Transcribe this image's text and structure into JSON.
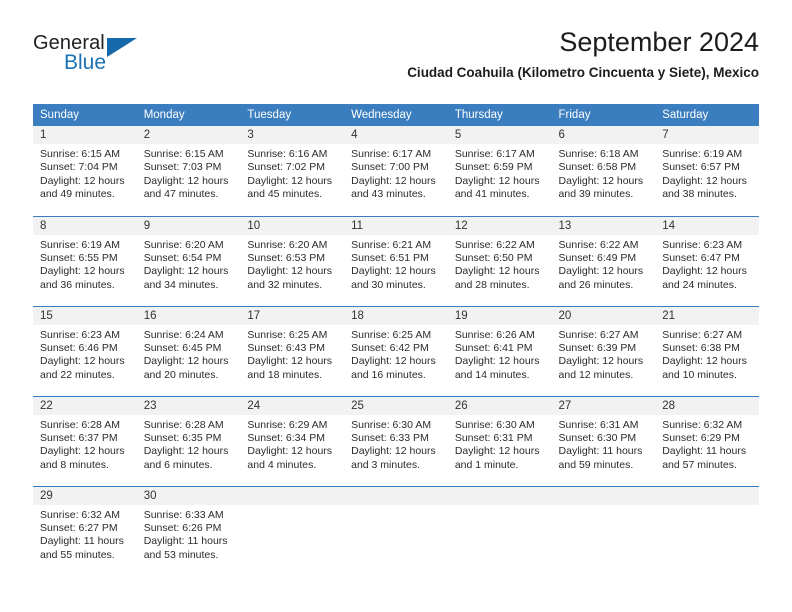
{
  "branding": {
    "name_part1": "General",
    "name_part2": "Blue",
    "accent_color": "#1569ab"
  },
  "header": {
    "title": "September 2024",
    "subtitle": "Ciudad Coahuila (Kilometro Cincuenta y Siete), Mexico"
  },
  "theme": {
    "header_bg": "#3a7ebf",
    "daynum_bg": "#f2f2f2",
    "grid_line": "#3a7ebf"
  },
  "weekdays": [
    "Sunday",
    "Monday",
    "Tuesday",
    "Wednesday",
    "Thursday",
    "Friday",
    "Saturday"
  ],
  "weeks": [
    [
      {
        "day": "1",
        "sunrise": "Sunrise: 6:15 AM",
        "sunset": "Sunset: 7:04 PM",
        "daylight1": "Daylight: 12 hours",
        "daylight2": "and 49 minutes."
      },
      {
        "day": "2",
        "sunrise": "Sunrise: 6:15 AM",
        "sunset": "Sunset: 7:03 PM",
        "daylight1": "Daylight: 12 hours",
        "daylight2": "and 47 minutes."
      },
      {
        "day": "3",
        "sunrise": "Sunrise: 6:16 AM",
        "sunset": "Sunset: 7:02 PM",
        "daylight1": "Daylight: 12 hours",
        "daylight2": "and 45 minutes."
      },
      {
        "day": "4",
        "sunrise": "Sunrise: 6:17 AM",
        "sunset": "Sunset: 7:00 PM",
        "daylight1": "Daylight: 12 hours",
        "daylight2": "and 43 minutes."
      },
      {
        "day": "5",
        "sunrise": "Sunrise: 6:17 AM",
        "sunset": "Sunset: 6:59 PM",
        "daylight1": "Daylight: 12 hours",
        "daylight2": "and 41 minutes."
      },
      {
        "day": "6",
        "sunrise": "Sunrise: 6:18 AM",
        "sunset": "Sunset: 6:58 PM",
        "daylight1": "Daylight: 12 hours",
        "daylight2": "and 39 minutes."
      },
      {
        "day": "7",
        "sunrise": "Sunrise: 6:19 AM",
        "sunset": "Sunset: 6:57 PM",
        "daylight1": "Daylight: 12 hours",
        "daylight2": "and 38 minutes."
      }
    ],
    [
      {
        "day": "8",
        "sunrise": "Sunrise: 6:19 AM",
        "sunset": "Sunset: 6:55 PM",
        "daylight1": "Daylight: 12 hours",
        "daylight2": "and 36 minutes."
      },
      {
        "day": "9",
        "sunrise": "Sunrise: 6:20 AM",
        "sunset": "Sunset: 6:54 PM",
        "daylight1": "Daylight: 12 hours",
        "daylight2": "and 34 minutes."
      },
      {
        "day": "10",
        "sunrise": "Sunrise: 6:20 AM",
        "sunset": "Sunset: 6:53 PM",
        "daylight1": "Daylight: 12 hours",
        "daylight2": "and 32 minutes."
      },
      {
        "day": "11",
        "sunrise": "Sunrise: 6:21 AM",
        "sunset": "Sunset: 6:51 PM",
        "daylight1": "Daylight: 12 hours",
        "daylight2": "and 30 minutes."
      },
      {
        "day": "12",
        "sunrise": "Sunrise: 6:22 AM",
        "sunset": "Sunset: 6:50 PM",
        "daylight1": "Daylight: 12 hours",
        "daylight2": "and 28 minutes."
      },
      {
        "day": "13",
        "sunrise": "Sunrise: 6:22 AM",
        "sunset": "Sunset: 6:49 PM",
        "daylight1": "Daylight: 12 hours",
        "daylight2": "and 26 minutes."
      },
      {
        "day": "14",
        "sunrise": "Sunrise: 6:23 AM",
        "sunset": "Sunset: 6:47 PM",
        "daylight1": "Daylight: 12 hours",
        "daylight2": "and 24 minutes."
      }
    ],
    [
      {
        "day": "15",
        "sunrise": "Sunrise: 6:23 AM",
        "sunset": "Sunset: 6:46 PM",
        "daylight1": "Daylight: 12 hours",
        "daylight2": "and 22 minutes."
      },
      {
        "day": "16",
        "sunrise": "Sunrise: 6:24 AM",
        "sunset": "Sunset: 6:45 PM",
        "daylight1": "Daylight: 12 hours",
        "daylight2": "and 20 minutes."
      },
      {
        "day": "17",
        "sunrise": "Sunrise: 6:25 AM",
        "sunset": "Sunset: 6:43 PM",
        "daylight1": "Daylight: 12 hours",
        "daylight2": "and 18 minutes."
      },
      {
        "day": "18",
        "sunrise": "Sunrise: 6:25 AM",
        "sunset": "Sunset: 6:42 PM",
        "daylight1": "Daylight: 12 hours",
        "daylight2": "and 16 minutes."
      },
      {
        "day": "19",
        "sunrise": "Sunrise: 6:26 AM",
        "sunset": "Sunset: 6:41 PM",
        "daylight1": "Daylight: 12 hours",
        "daylight2": "and 14 minutes."
      },
      {
        "day": "20",
        "sunrise": "Sunrise: 6:27 AM",
        "sunset": "Sunset: 6:39 PM",
        "daylight1": "Daylight: 12 hours",
        "daylight2": "and 12 minutes."
      },
      {
        "day": "21",
        "sunrise": "Sunrise: 6:27 AM",
        "sunset": "Sunset: 6:38 PM",
        "daylight1": "Daylight: 12 hours",
        "daylight2": "and 10 minutes."
      }
    ],
    [
      {
        "day": "22",
        "sunrise": "Sunrise: 6:28 AM",
        "sunset": "Sunset: 6:37 PM",
        "daylight1": "Daylight: 12 hours",
        "daylight2": "and 8 minutes."
      },
      {
        "day": "23",
        "sunrise": "Sunrise: 6:28 AM",
        "sunset": "Sunset: 6:35 PM",
        "daylight1": "Daylight: 12 hours",
        "daylight2": "and 6 minutes."
      },
      {
        "day": "24",
        "sunrise": "Sunrise: 6:29 AM",
        "sunset": "Sunset: 6:34 PM",
        "daylight1": "Daylight: 12 hours",
        "daylight2": "and 4 minutes."
      },
      {
        "day": "25",
        "sunrise": "Sunrise: 6:30 AM",
        "sunset": "Sunset: 6:33 PM",
        "daylight1": "Daylight: 12 hours",
        "daylight2": "and 3 minutes."
      },
      {
        "day": "26",
        "sunrise": "Sunrise: 6:30 AM",
        "sunset": "Sunset: 6:31 PM",
        "daylight1": "Daylight: 12 hours",
        "daylight2": "and 1 minute."
      },
      {
        "day": "27",
        "sunrise": "Sunrise: 6:31 AM",
        "sunset": "Sunset: 6:30 PM",
        "daylight1": "Daylight: 11 hours",
        "daylight2": "and 59 minutes."
      },
      {
        "day": "28",
        "sunrise": "Sunrise: 6:32 AM",
        "sunset": "Sunset: 6:29 PM",
        "daylight1": "Daylight: 11 hours",
        "daylight2": "and 57 minutes."
      }
    ],
    [
      {
        "day": "29",
        "sunrise": "Sunrise: 6:32 AM",
        "sunset": "Sunset: 6:27 PM",
        "daylight1": "Daylight: 11 hours",
        "daylight2": "and 55 minutes."
      },
      {
        "day": "30",
        "sunrise": "Sunrise: 6:33 AM",
        "sunset": "Sunset: 6:26 PM",
        "daylight1": "Daylight: 11 hours",
        "daylight2": "and 53 minutes."
      },
      {
        "day": "",
        "sunrise": "",
        "sunset": "",
        "daylight1": "",
        "daylight2": ""
      },
      {
        "day": "",
        "sunrise": "",
        "sunset": "",
        "daylight1": "",
        "daylight2": ""
      },
      {
        "day": "",
        "sunrise": "",
        "sunset": "",
        "daylight1": "",
        "daylight2": ""
      },
      {
        "day": "",
        "sunrise": "",
        "sunset": "",
        "daylight1": "",
        "daylight2": ""
      },
      {
        "day": "",
        "sunrise": "",
        "sunset": "",
        "daylight1": "",
        "daylight2": ""
      }
    ]
  ]
}
